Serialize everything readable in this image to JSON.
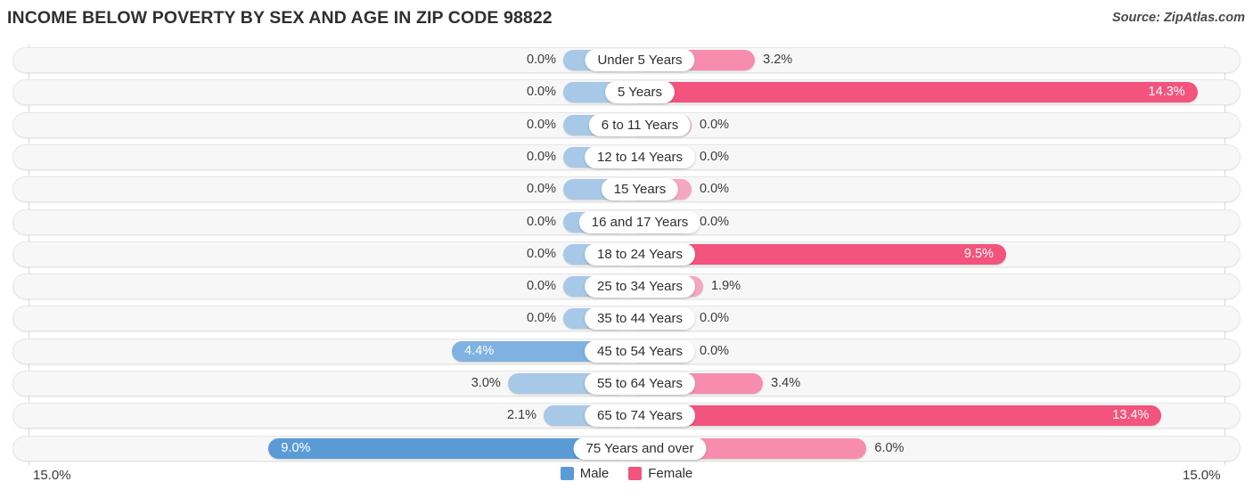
{
  "header": {
    "title": "INCOME BELOW POVERTY BY SEX AND AGE IN ZIP CODE 98822",
    "source": "Source: ZipAtlas.com"
  },
  "legend": {
    "male_label": "Male",
    "female_label": "Female",
    "male_color": "#5b9bd5",
    "female_color": "#f2547d"
  },
  "axis": {
    "left_label": "15.0%",
    "right_label": "15.0%",
    "max": 15.0
  },
  "colors": {
    "male_light": "#a8c8e8",
    "male_mid": "#7fb2e0",
    "male_strong": "#5b9bd5",
    "female_light": "#f6a6c0",
    "female_mid": "#f78cae",
    "female_strong": "#f2547d",
    "row_track": "#f7f7f7",
    "row_border": "#e6e6e6",
    "axis_line": "#d9d9d9"
  },
  "chart_data": {
    "type": "bar",
    "title": "Income Below Poverty by Sex and Age in Zip Code 98822",
    "subtitle": "Source: ZipAtlas.com",
    "orientation": "horizontal-diverging",
    "xlabel": "",
    "ylabel": "",
    "xlim": [
      -15.0,
      15.0
    ],
    "unit": "%",
    "grid": false,
    "legend_position": "bottom-center",
    "categories": [
      "Under 5 Years",
      "5 Years",
      "6 to 11 Years",
      "12 to 14 Years",
      "15 Years",
      "16 and 17 Years",
      "18 to 24 Years",
      "25 to 34 Years",
      "35 to 44 Years",
      "45 to 54 Years",
      "55 to 64 Years",
      "65 to 74 Years",
      "75 Years and over"
    ],
    "series": [
      {
        "name": "Male",
        "values": [
          0.0,
          0.0,
          0.0,
          0.0,
          0.0,
          0.0,
          0.0,
          0.0,
          0.0,
          4.4,
          3.0,
          2.1,
          9.0
        ],
        "labels": [
          "0.0%",
          "0.0%",
          "0.0%",
          "0.0%",
          "0.0%",
          "0.0%",
          "0.0%",
          "0.0%",
          "0.0%",
          "4.4%",
          "3.0%",
          "2.1%",
          "9.0%"
        ]
      },
      {
        "name": "Female",
        "values": [
          3.2,
          14.3,
          0.0,
          0.0,
          0.0,
          0.0,
          9.5,
          1.9,
          0.0,
          0.0,
          3.4,
          13.4,
          6.0
        ],
        "labels": [
          "3.2%",
          "14.3%",
          "0.0%",
          "0.0%",
          "0.0%",
          "0.0%",
          "9.5%",
          "1.9%",
          "0.0%",
          "0.0%",
          "3.4%",
          "13.4%",
          "6.0%"
        ]
      }
    ]
  }
}
